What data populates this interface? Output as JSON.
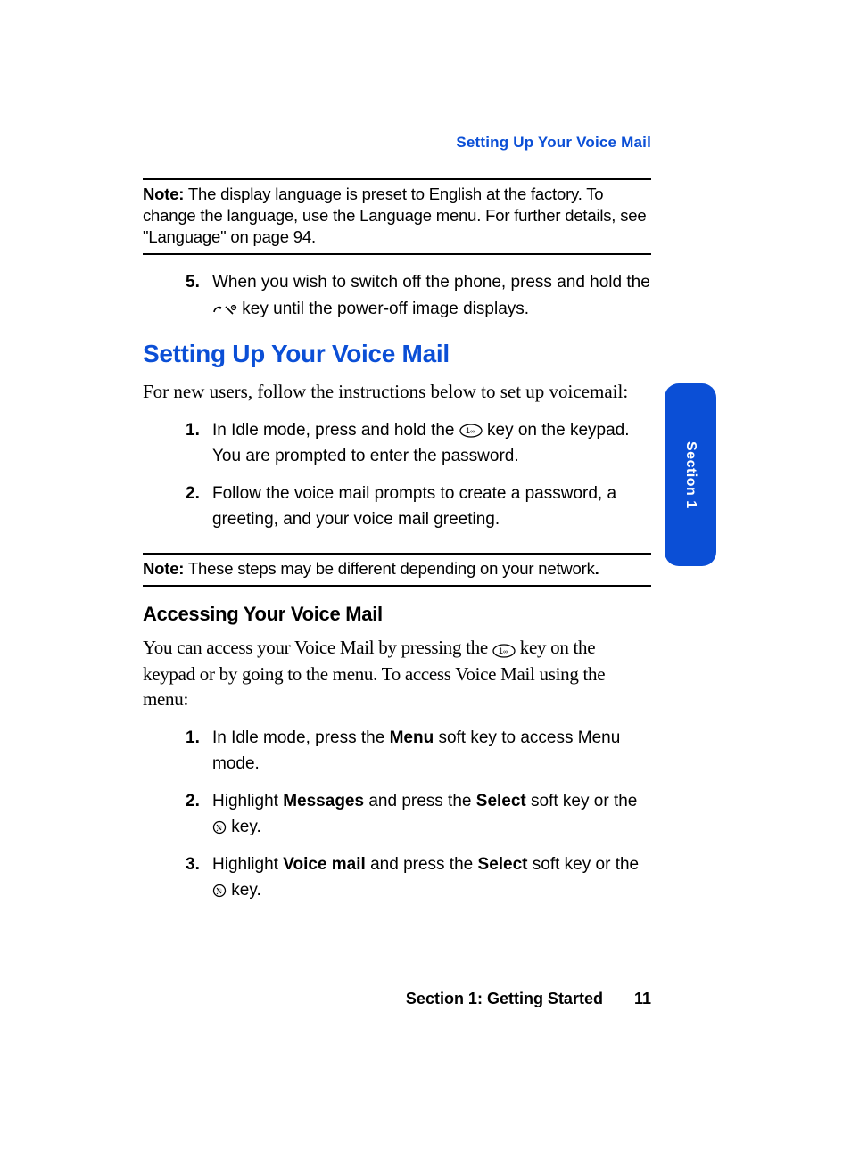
{
  "running_header": "Setting Up Your Voice Mail",
  "note1": {
    "label": "Note:",
    "text": " The display language is preset to English at the factory. To change the language, use the Language menu. For further details, see \"Language\" on page 94."
  },
  "step5": {
    "num": "5.",
    "before_icon": "When you wish to switch off the phone, press and hold the ",
    "after_icon": " key until the power-off image displays."
  },
  "heading": "Setting Up Your Voice Mail",
  "intro": "For new users, follow the instructions below to set up voicemail:",
  "setup_steps": {
    "s1": {
      "num": "1.",
      "before_icon": "In Idle mode, press and hold the ",
      "after_icon": " key on the keypad. You are prompted to enter the password."
    },
    "s2": {
      "num": "2.",
      "text": "Follow the voice mail prompts to create a password, a greeting, and your voice mail greeting."
    }
  },
  "note2": {
    "label": "Note:",
    "text": " These steps may be different depending on your network",
    "end": "."
  },
  "subheading": "Accessing Your Voice Mail",
  "access_intro": {
    "before_icon": "You can access your Voice Mail by pressing the ",
    "after_icon": " key on the keypad or by going to the menu. To access Voice Mail using the menu:"
  },
  "access_steps": {
    "a1": {
      "num": "1.",
      "p1": "In Idle mode, press the ",
      "b1": "Menu",
      "p2": " soft key to access Menu mode."
    },
    "a2": {
      "num": "2.",
      "p1": "Highlight ",
      "b1": "Messages",
      "p2": " and press the ",
      "b2": "Select",
      "p3": " soft key or the ",
      "p4": " key."
    },
    "a3": {
      "num": "3.",
      "p1": "Highlight ",
      "b1": "Voice mail",
      "p2": " and press the ",
      "b2": "Select",
      "p3": " soft key or the ",
      "p4": " key."
    }
  },
  "footer": {
    "section": "Section 1: Getting Started",
    "page": "11"
  },
  "tab": "Section 1"
}
